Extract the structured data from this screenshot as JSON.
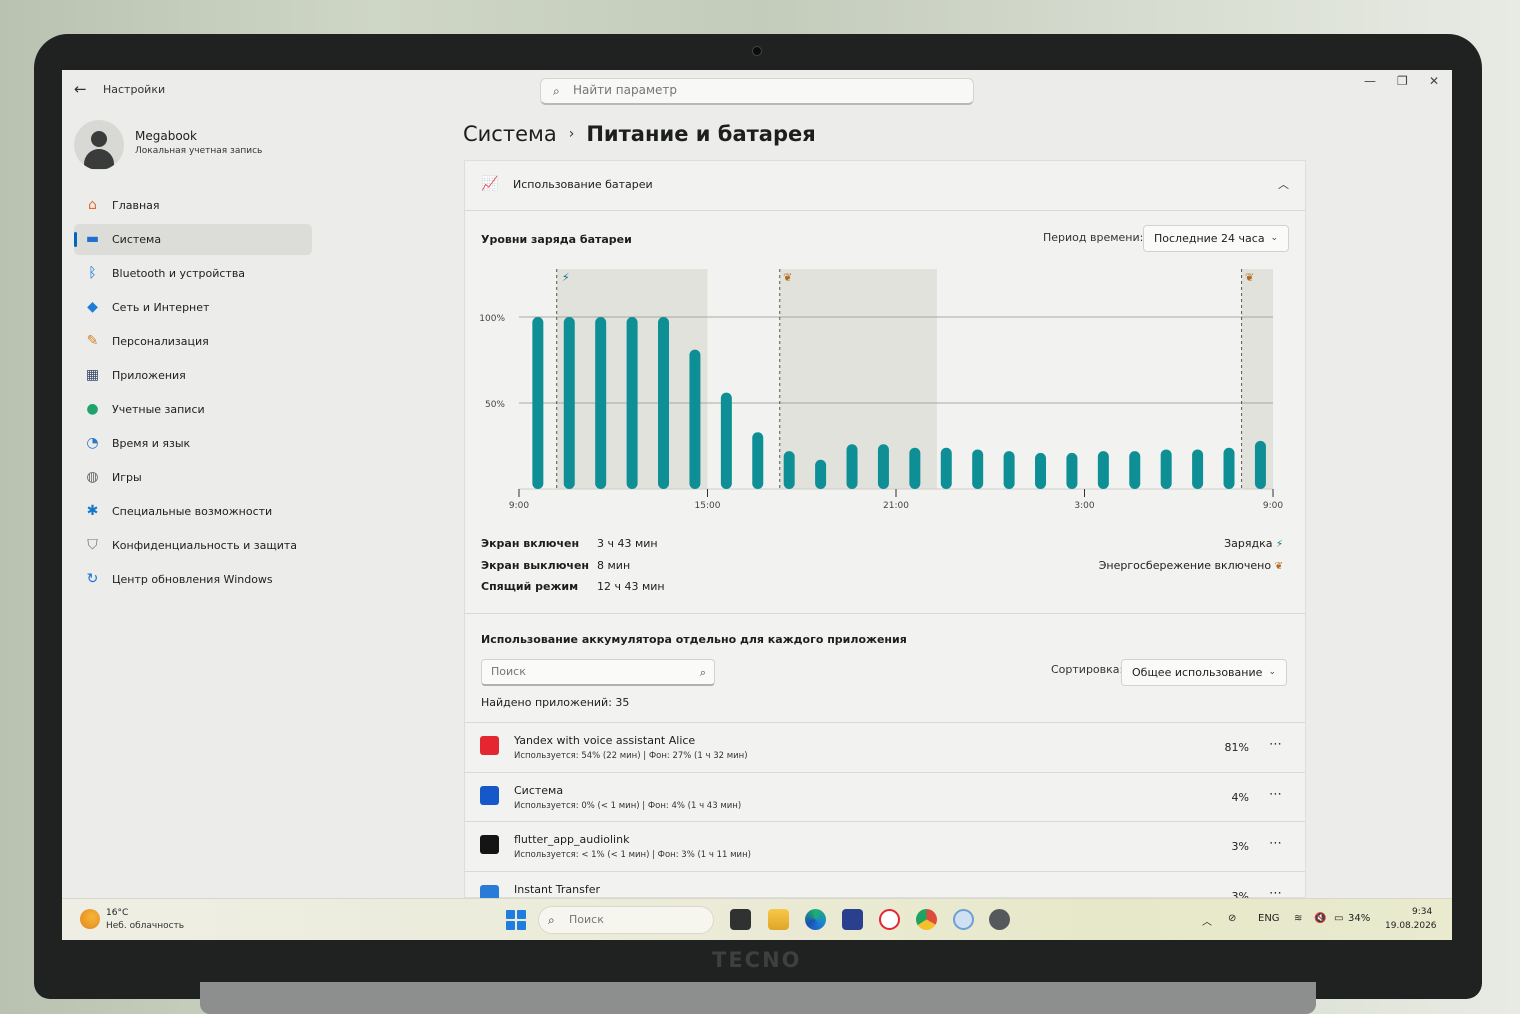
{
  "window": {
    "app_title": "Настройки",
    "search_placeholder": "Найти параметр",
    "minimize": "—",
    "maximize": "❐",
    "close": "✕"
  },
  "profile": {
    "name": "Megabook",
    "subtitle": "Локальная учетная запись"
  },
  "nav": [
    {
      "label": "Главная",
      "icon": "home-icon",
      "color": "#e26b30"
    },
    {
      "label": "Система",
      "icon": "system-icon",
      "color": "#1f6fd1",
      "active": true
    },
    {
      "label": "Bluetooth и устройства",
      "icon": "bluetooth-icon",
      "color": "#0a6fd6"
    },
    {
      "label": "Сеть и Интернет",
      "icon": "wifi-icon",
      "color": "#1c7cd6"
    },
    {
      "label": "Персонализация",
      "icon": "brush-icon",
      "color": "#d9822b"
    },
    {
      "label": "Приложения",
      "icon": "apps-icon",
      "color": "#3b4a6b"
    },
    {
      "label": "Учетные записи",
      "icon": "account-icon",
      "color": "#1fa36a"
    },
    {
      "label": "Время и язык",
      "icon": "globe-clock-icon",
      "color": "#2b78c6"
    },
    {
      "label": "Игры",
      "icon": "gamepad-icon",
      "color": "#606565"
    },
    {
      "label": "Специальные возможности",
      "icon": "accessibility-icon",
      "color": "#1478c8"
    },
    {
      "label": "Конфиденциальность и защита",
      "icon": "shield-icon",
      "color": "#6c7272"
    },
    {
      "label": "Центр обновления Windows",
      "icon": "update-icon",
      "color": "#1a72d4"
    }
  ],
  "breadcrumb": {
    "parent": "Система",
    "separator": "›",
    "current": "Питание и батарея"
  },
  "battery_usage": {
    "header": "Использование батареи",
    "levels_title": "Уровни заряда батареи",
    "period_label": "Период времени:",
    "period_value": "Последние 24 часа"
  },
  "chart_data": {
    "type": "bar",
    "y_ticks": [
      "100%",
      "50%"
    ],
    "x_ticks": [
      "9:00",
      "15:00",
      "21:00",
      "3:00",
      "9:00"
    ],
    "ylim": [
      0,
      100
    ],
    "bar_color": "#0e8f96",
    "values": [
      100,
      100,
      100,
      100,
      100,
      81,
      56,
      33,
      22,
      17,
      26,
      26,
      24,
      24,
      23,
      22,
      21,
      21,
      22,
      22,
      23,
      23,
      24,
      28
    ],
    "charging_markers": [
      1.2
    ],
    "saver_markers": [
      8.3,
      23.0
    ],
    "shaded_ranges": [
      [
        1.2,
        6.0
      ],
      [
        8.3,
        13.3
      ],
      [
        23.0,
        24.0
      ]
    ]
  },
  "stats": [
    {
      "label": "Экран включен",
      "value": "3 ч 43 мин"
    },
    {
      "label": "Экран выключен",
      "value": "8 мин"
    },
    {
      "label": "Спящий режим",
      "value": "12 ч 43 мин"
    }
  ],
  "legend": {
    "charging": "Зарядка",
    "saver": "Энергосбережение включено"
  },
  "apps_section": {
    "title": "Использование аккумулятора отдельно для каждого приложения",
    "search_placeholder": "Поиск",
    "sort_label": "Сортировка:",
    "sort_value": "Общее использование",
    "found": "Найдено приложений: 35"
  },
  "apps": [
    {
      "name": "Yandex with voice assistant Alice",
      "detail": "Используется: 54% (22 мин) | Фон: 27% (1 ч 32 мин)",
      "percent": "81%",
      "icon": "yandex-browser-icon",
      "color": "#e3262f"
    },
    {
      "name": "Система",
      "detail": "Используется: 0% (< 1 мин) | Фон: 4% (1 ч 43 мин)",
      "percent": "4%",
      "icon": "system-app-icon",
      "color": "#1657c9"
    },
    {
      "name": "flutter_app_audiolink",
      "detail": "Используется: < 1% (< 1 мин) | Фон: 3% (1 ч 11 мин)",
      "percent": "3%",
      "icon": "audiolink-icon",
      "color": "#141414"
    },
    {
      "name": "Instant Transfer",
      "detail": "",
      "percent": "3%",
      "icon": "instant-transfer-icon",
      "color": "#2a7bd8"
    }
  ],
  "taskbar": {
    "temp": "16°C",
    "weather": "Неб. облачность",
    "search_placeholder": "Поиск",
    "lang": "ENG",
    "battery": "34%",
    "time": "9:34",
    "date": "19.08.2026"
  },
  "bezel": {
    "brand": "TECNO"
  }
}
